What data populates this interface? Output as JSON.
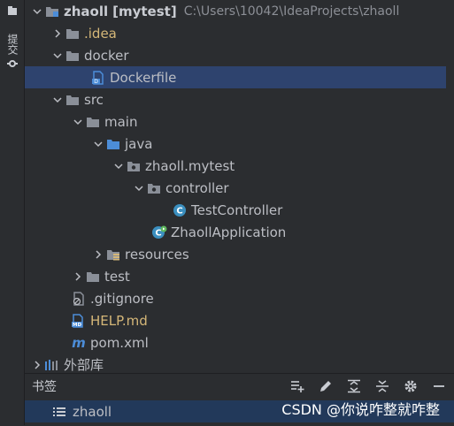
{
  "left_strip": {
    "commit_label": "提交"
  },
  "project": {
    "name": "zhaoll",
    "module_tag": "[mytest]",
    "path": "C:\\Users\\10042\\IdeaProjects\\zhaoll"
  },
  "tree": {
    "idea": ".idea",
    "docker": "docker",
    "dockerfile": "Dockerfile",
    "src": "src",
    "main": "main",
    "java": "java",
    "package": "zhaoll.mytest",
    "controller": "controller",
    "test_controller": "TestController",
    "app": "ZhaollApplication",
    "resources": "resources",
    "test": "test",
    "gitignore": ".gitignore",
    "help": "HELP.md",
    "pom": "pom.xml",
    "ext_libs": "外部库"
  },
  "bookmarks": {
    "title": "书签",
    "item": "zhaoll"
  },
  "watermark": "CSDN @你说咋整就咋整"
}
